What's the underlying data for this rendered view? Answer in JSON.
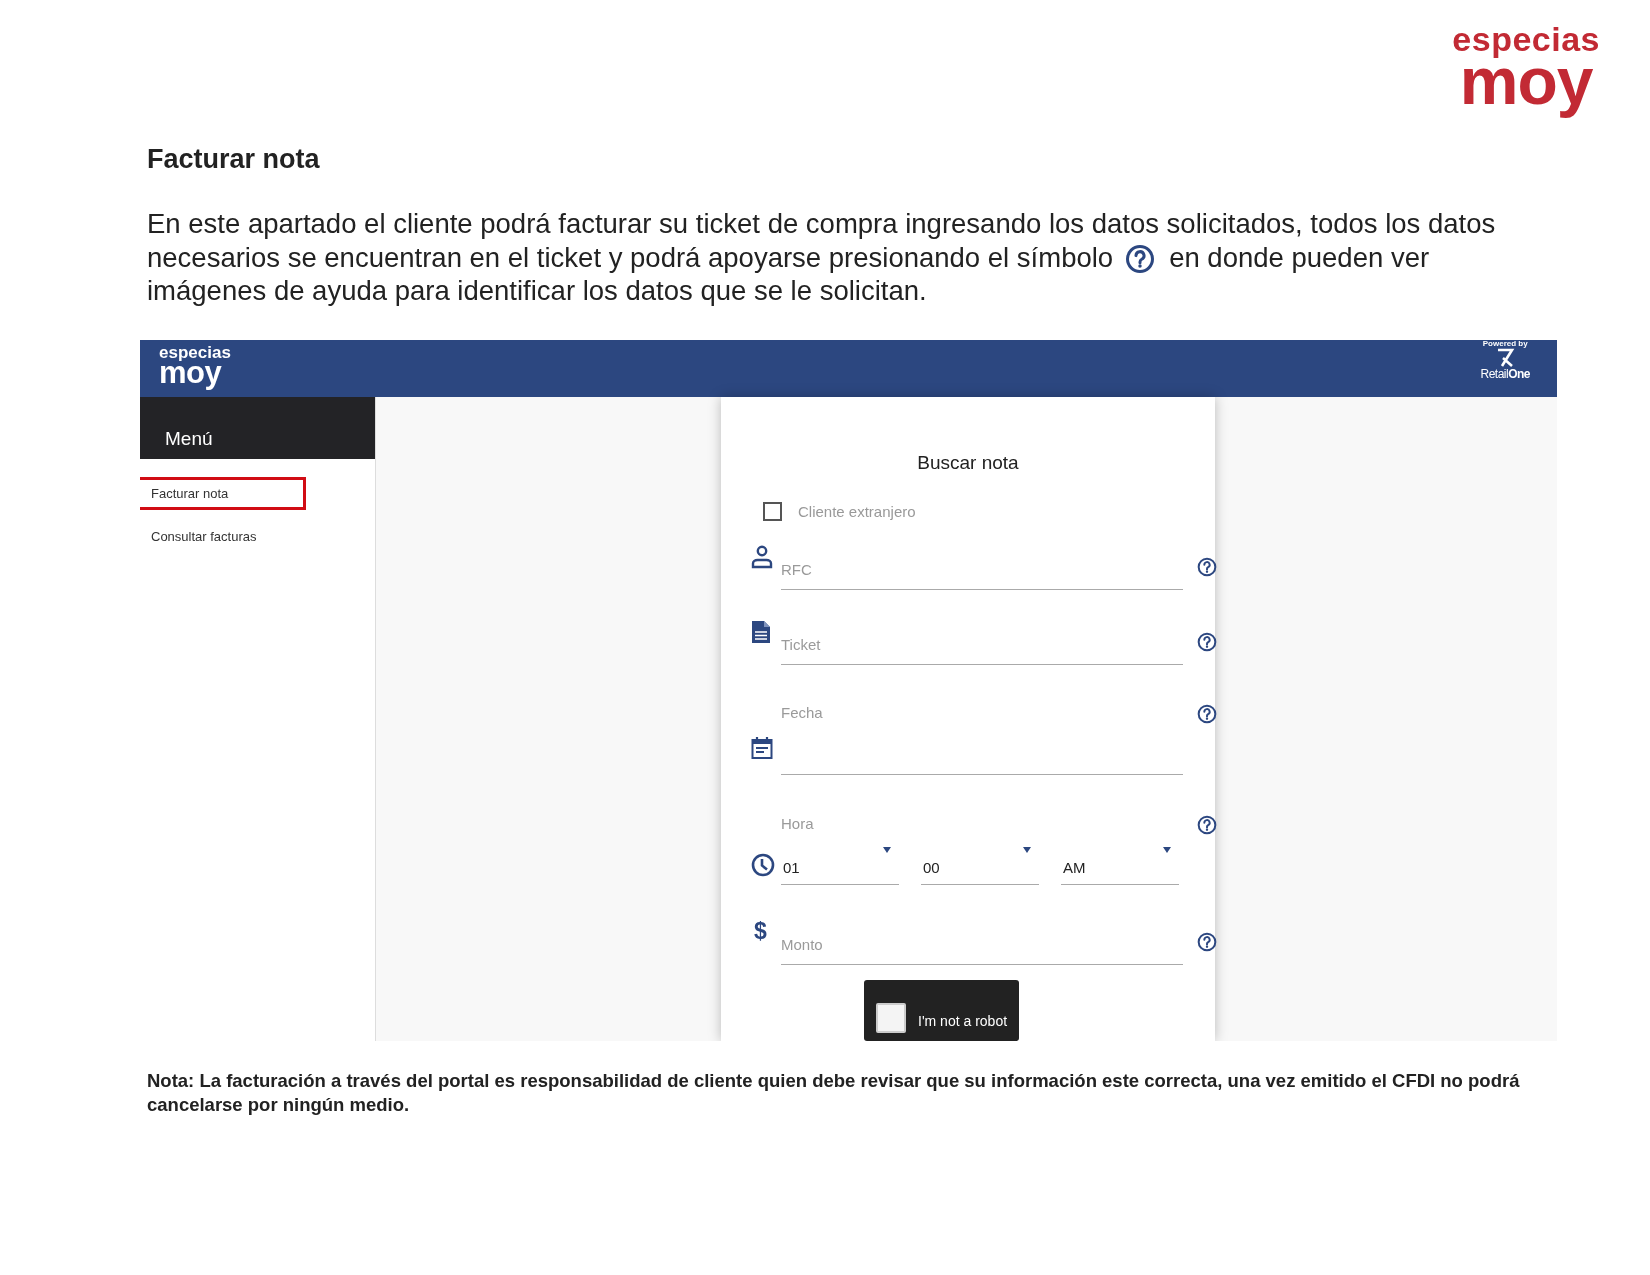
{
  "brand": {
    "top": "especias",
    "bottom": "moy"
  },
  "heading": "Facturar nota",
  "intro": {
    "line_1": "En este apartado el cliente podrá facturar su ticket de compra ingresando los datos solicitados, todos los datos",
    "before_icon": "necesarios se encuentran en el ticket y podrá apoyarse presionando el símbolo",
    "after_icon": "en donde pueden ver",
    "line_3": "imágenes de ayuda para identificar los datos que se le solicitan."
  },
  "app": {
    "header": {
      "logo_top": "especias",
      "logo_bottom": "moy",
      "powered_by": "Powered by",
      "vendor": "Retail**One**"
    },
    "sidebar": {
      "title": "Menú",
      "items": [
        {
          "label": "Facturar nota",
          "highlighted": true
        },
        {
          "label": "Consultar facturas",
          "highlighted": false
        }
      ]
    },
    "form": {
      "title": "Buscar nota",
      "foreign_client": {
        "label": "Cliente extranjero",
        "checked": false
      },
      "fields": [
        {
          "kind": "text",
          "placeholder": "RFC"
        },
        {
          "kind": "text",
          "placeholder": "Ticket"
        },
        {
          "kind": "date",
          "label": "Fecha"
        },
        {
          "kind": "time",
          "label": "Hora",
          "selects": [
            "01",
            "00",
            "AM"
          ]
        },
        {
          "kind": "text",
          "symbol": "$",
          "placeholder": "Monto"
        }
      ],
      "captcha": {
        "label": "I'm not a robot",
        "checked": false
      }
    }
  },
  "note": "Nota: La facturación a través del portal es responsabilidad de cliente quien debe revisar que su información este correcta, una vez emitido el CFDI no podrá cancelarse por ningún medio."
}
